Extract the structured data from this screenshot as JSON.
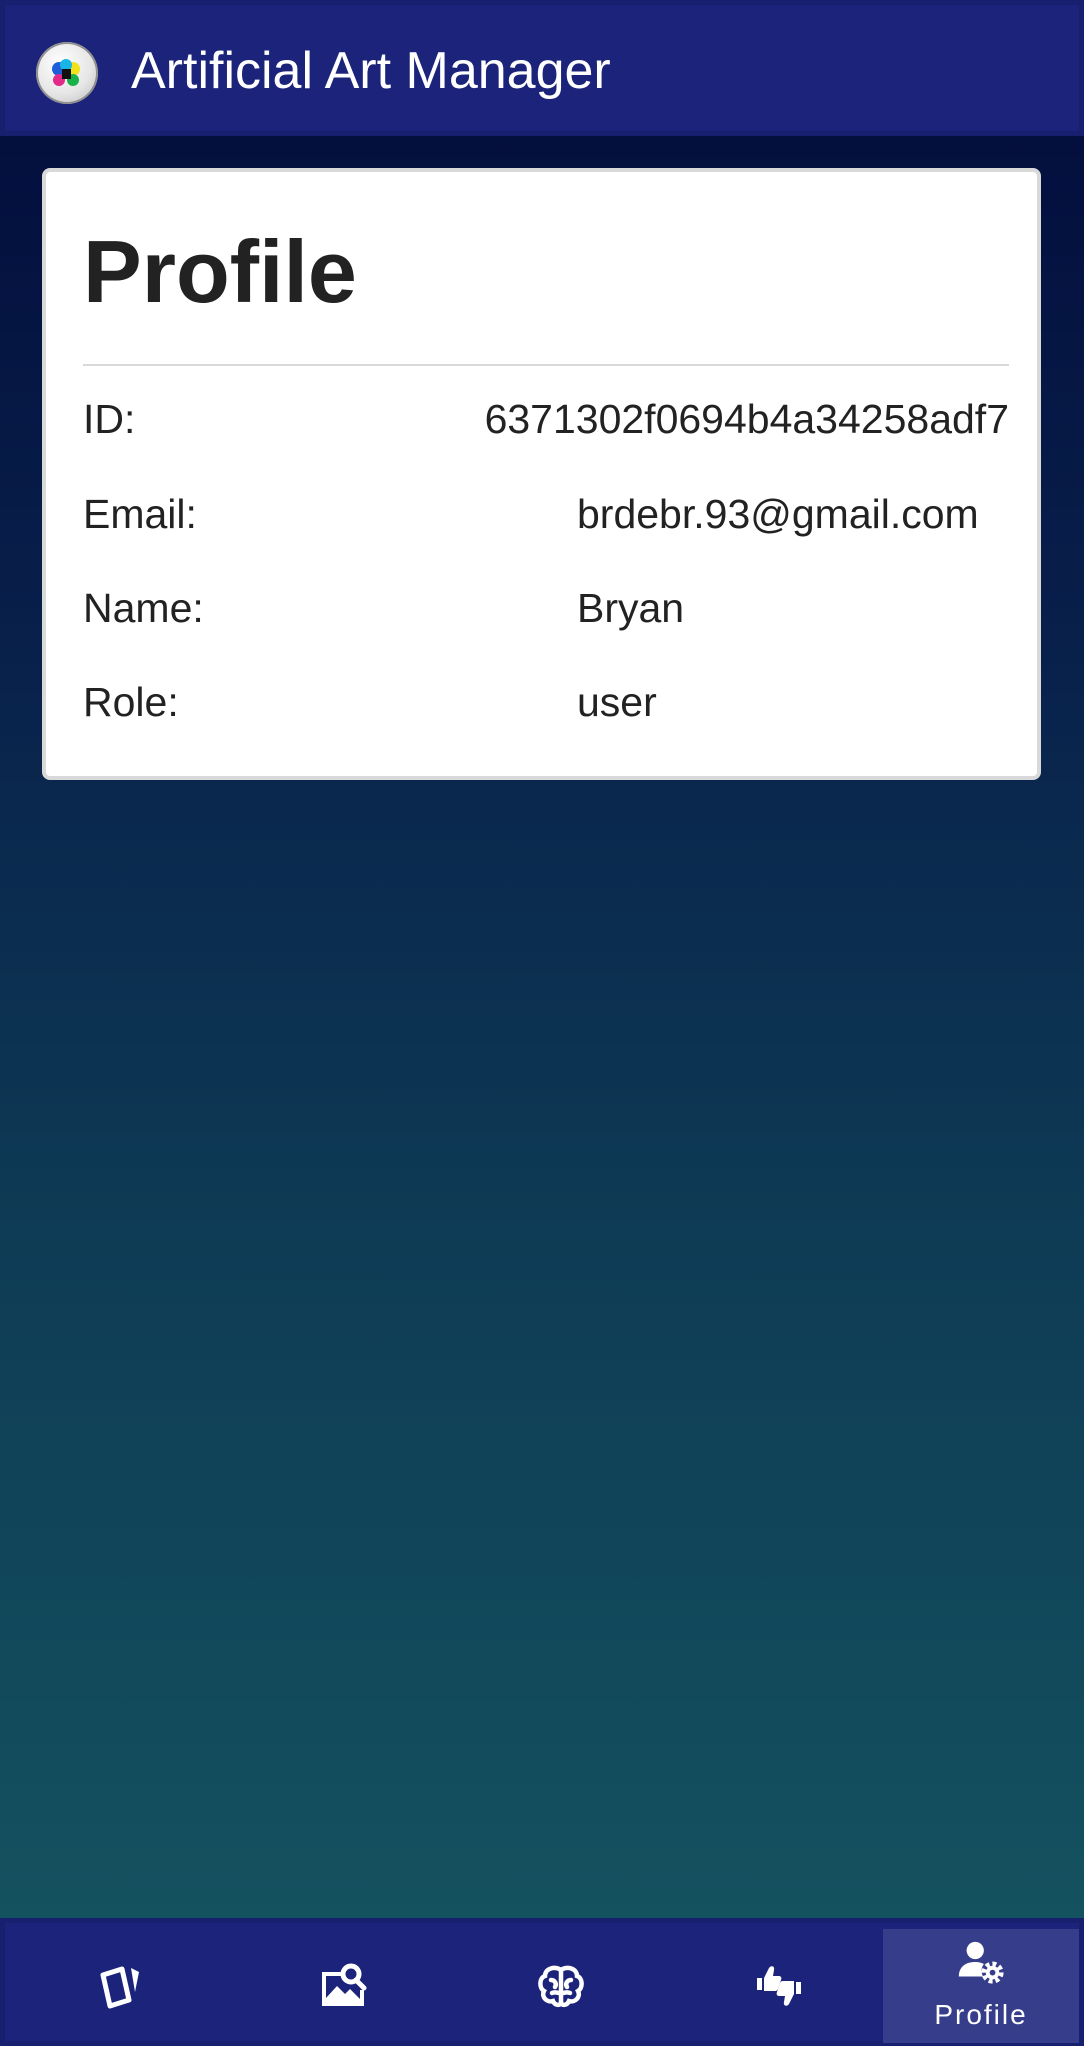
{
  "app": {
    "title": "Artificial Art Manager",
    "logo_icon": "color-palette-logo-icon"
  },
  "profile": {
    "heading": "Profile",
    "fields": [
      {
        "label": "ID:",
        "value": "6371302f0694b4a34258adf7"
      },
      {
        "label": "Email:",
        "value": "brdebr.93@gmail.com"
      },
      {
        "label": "Name:",
        "value": "Bryan"
      },
      {
        "label": "Role:",
        "value": "user"
      }
    ]
  },
  "nav": {
    "items": [
      {
        "icon": "cards-icon",
        "label": ""
      },
      {
        "icon": "image-search-icon",
        "label": ""
      },
      {
        "icon": "brain-icon",
        "label": ""
      },
      {
        "icon": "thumbs-up-down-icon",
        "label": ""
      },
      {
        "icon": "user-settings-icon",
        "label": "Profile",
        "active": true
      }
    ]
  },
  "colors": {
    "app_bar": "#1b237b",
    "nav_active": "#363e8c",
    "gradient_top": "#020a3a",
    "gradient_bottom": "#155661",
    "card": "#ffffff",
    "text": "#222222"
  }
}
